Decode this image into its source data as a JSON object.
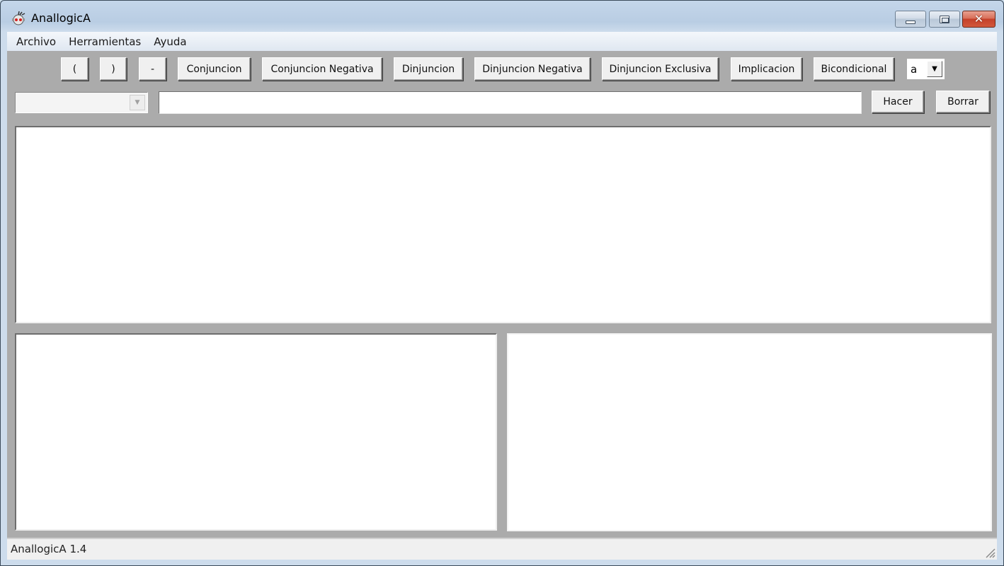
{
  "window": {
    "title": "AnallogicA",
    "icon": "bug-robot-icon",
    "controls": {
      "minimize": "minimize-icon",
      "maximize": "maximize-icon",
      "close": "close-icon"
    }
  },
  "menubar": {
    "items": [
      {
        "label": "Archivo"
      },
      {
        "label": "Herramientas"
      },
      {
        "label": "Ayuda"
      }
    ]
  },
  "toolbar": {
    "buttons": [
      {
        "label": "("
      },
      {
        "label": ")"
      },
      {
        "label": "-"
      },
      {
        "label": "Conjuncion"
      },
      {
        "label": "Conjuncion Negativa"
      },
      {
        "label": "Dinjuncion"
      },
      {
        "label": "Dinjuncion Negativa"
      },
      {
        "label": "Dinjuncion Exclusiva"
      },
      {
        "label": "Implicacion"
      },
      {
        "label": "Bicondicional"
      }
    ],
    "variable_select": {
      "value": "a"
    }
  },
  "input_row": {
    "combo_value": "",
    "formula_value": "",
    "formula_placeholder": "",
    "hacer_label": "Hacer",
    "borrar_label": "Borrar"
  },
  "statusbar": {
    "text": "AnallogicA 1.4"
  }
}
